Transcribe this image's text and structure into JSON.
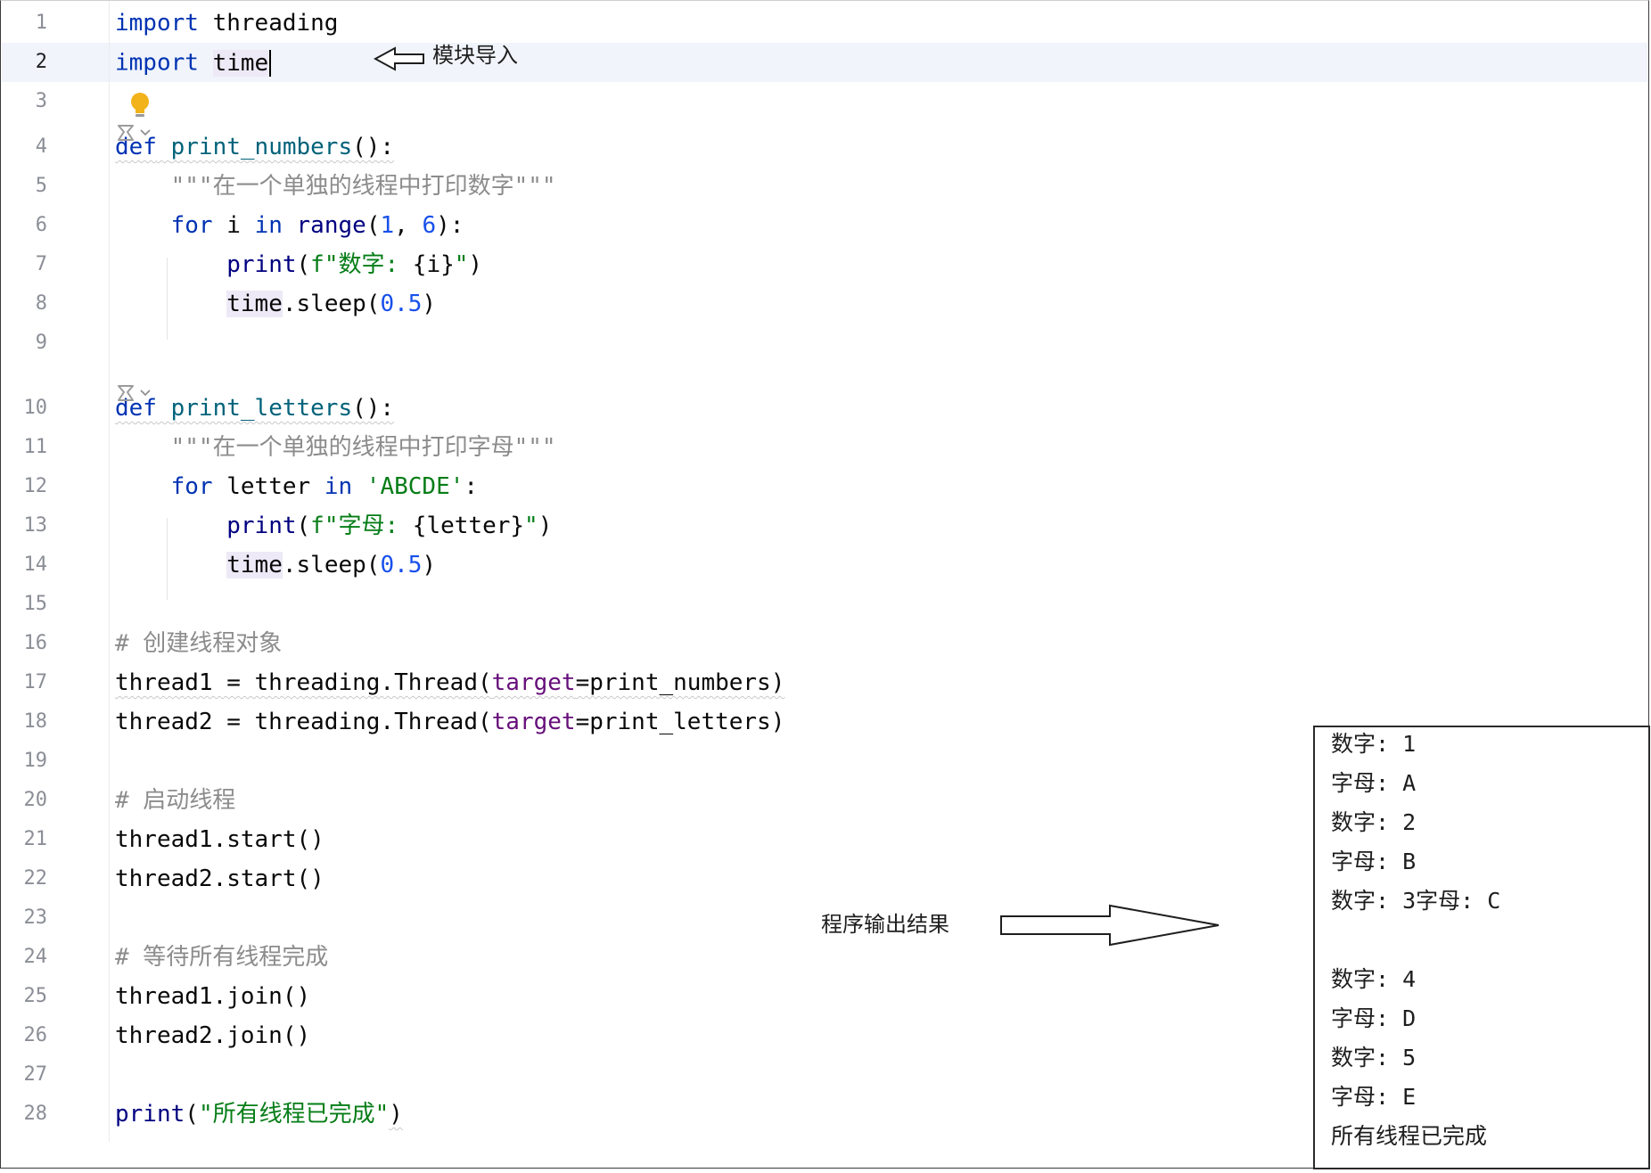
{
  "editor": {
    "lines": [
      {
        "n": "1",
        "tokens": [
          [
            "kw",
            "import"
          ],
          [
            "pl",
            " threading"
          ]
        ]
      },
      {
        "n": "2",
        "current": true,
        "cursor": true,
        "tokens": [
          [
            "kw",
            "import"
          ],
          [
            "pl",
            " "
          ],
          [
            "pl hl",
            "time"
          ]
        ]
      },
      {
        "n": "3",
        "tokens": []
      },
      {
        "n": "4",
        "tokens": [
          [
            "kw wavy",
            "def"
          ],
          [
            "pl wavy",
            " "
          ],
          [
            "fn wavy",
            "print_numbers"
          ],
          [
            "pl wavy",
            "():"
          ]
        ]
      },
      {
        "n": "5",
        "tokens": [
          [
            "pl",
            "    "
          ],
          [
            "doc",
            "\"\"\"在一个单独的线程中打印数字\"\"\""
          ]
        ]
      },
      {
        "n": "6",
        "tokens": [
          [
            "pl",
            "    "
          ],
          [
            "kw",
            "for"
          ],
          [
            "pl",
            " i "
          ],
          [
            "kw",
            "in"
          ],
          [
            "pl",
            " "
          ],
          [
            "builtin",
            "range"
          ],
          [
            "pl",
            "("
          ],
          [
            "num",
            "1"
          ],
          [
            "pl",
            ", "
          ],
          [
            "num",
            "6"
          ],
          [
            "pl",
            "):"
          ]
        ]
      },
      {
        "n": "7",
        "tokens": [
          [
            "pl",
            "        "
          ],
          [
            "builtin",
            "print"
          ],
          [
            "pl",
            "("
          ],
          [
            "str",
            "f\"数字: "
          ],
          [
            "pl",
            "{i}"
          ],
          [
            "str",
            "\""
          ],
          [
            "pl",
            ")"
          ]
        ]
      },
      {
        "n": "8",
        "tokens": [
          [
            "pl",
            "        "
          ],
          [
            "pl hl",
            "time"
          ],
          [
            "pl",
            ".sleep("
          ],
          [
            "num",
            "0.5"
          ],
          [
            "pl",
            ")"
          ]
        ]
      },
      {
        "n": "9",
        "tokens": []
      },
      {
        "n": "10",
        "tokens": [
          [
            "kw wavy",
            "def"
          ],
          [
            "pl wavy",
            " "
          ],
          [
            "fn wavy",
            "print_letters"
          ],
          [
            "pl wavy",
            "():"
          ]
        ]
      },
      {
        "n": "11",
        "tokens": [
          [
            "pl",
            "    "
          ],
          [
            "doc",
            "\"\"\"在一个单独的线程中打印字母\"\"\""
          ]
        ]
      },
      {
        "n": "12",
        "tokens": [
          [
            "pl",
            "    "
          ],
          [
            "kw",
            "for"
          ],
          [
            "pl",
            " letter "
          ],
          [
            "kw",
            "in"
          ],
          [
            "pl",
            " "
          ],
          [
            "str",
            "'ABCDE'"
          ],
          [
            "pl",
            ":"
          ]
        ]
      },
      {
        "n": "13",
        "tokens": [
          [
            "pl",
            "        "
          ],
          [
            "builtin",
            "print"
          ],
          [
            "pl",
            "("
          ],
          [
            "str",
            "f\"字母: "
          ],
          [
            "pl",
            "{letter}"
          ],
          [
            "str",
            "\""
          ],
          [
            "pl",
            ")"
          ]
        ]
      },
      {
        "n": "14",
        "tokens": [
          [
            "pl",
            "        "
          ],
          [
            "pl hl",
            "time"
          ],
          [
            "pl",
            ".sleep("
          ],
          [
            "num",
            "0.5"
          ],
          [
            "pl",
            ")"
          ]
        ]
      },
      {
        "n": "15",
        "tokens": []
      },
      {
        "n": "16",
        "tokens": [
          [
            "cm",
            "# 创建线程对象"
          ]
        ]
      },
      {
        "n": "17",
        "tokens": [
          [
            "pl wavy",
            "thread1 = threading.Thread("
          ],
          [
            "param wavy",
            "target"
          ],
          [
            "pl wavy",
            "=print_numbers)"
          ]
        ]
      },
      {
        "n": "18",
        "tokens": [
          [
            "pl",
            "thread2 = threading.Thread("
          ],
          [
            "param",
            "target"
          ],
          [
            "pl",
            "=print_letters)"
          ]
        ]
      },
      {
        "n": "19",
        "tokens": []
      },
      {
        "n": "20",
        "tokens": [
          [
            "cm",
            "# 启动线程"
          ]
        ]
      },
      {
        "n": "21",
        "tokens": [
          [
            "pl",
            "thread1.start()"
          ]
        ]
      },
      {
        "n": "22",
        "tokens": [
          [
            "pl",
            "thread2.start()"
          ]
        ]
      },
      {
        "n": "23",
        "tokens": []
      },
      {
        "n": "24",
        "tokens": [
          [
            "cm",
            "# 等待所有线程完成"
          ]
        ]
      },
      {
        "n": "25",
        "tokens": [
          [
            "pl",
            "thread1.join()"
          ]
        ]
      },
      {
        "n": "26",
        "tokens": [
          [
            "pl",
            "thread2.join()"
          ]
        ]
      },
      {
        "n": "27",
        "tokens": []
      },
      {
        "n": "28",
        "tokens": [
          [
            "builtin",
            "print"
          ],
          [
            "pl",
            "("
          ],
          [
            "str",
            "\"所有线程已完成\""
          ],
          [
            "pl wavy",
            ")"
          ]
        ]
      }
    ]
  },
  "annotations": {
    "module_import": "模块导入",
    "program_output": "程序输出结果"
  },
  "output": {
    "lines": [
      "数字: 1",
      "字母: A",
      "数字: 2",
      "字母: B",
      "数字: 3字母: C",
      "",
      "数字: 4",
      "字母: D",
      "数字: 5",
      "字母: E",
      "所有线程已完成"
    ]
  },
  "icons": {
    "intention_bulb": "lightbulb-icon",
    "inlay_hint": "ai-assistant-icon"
  },
  "colors": {
    "keyword": "#0033b3",
    "function_name": "#00627a",
    "builtin": "#000080",
    "number": "#1750eb",
    "string": "#067d17",
    "comment": "#8c8c8c",
    "named_param": "#660e7a",
    "caret_line": "#f1f4fb",
    "bulb": "#f2b21a"
  }
}
